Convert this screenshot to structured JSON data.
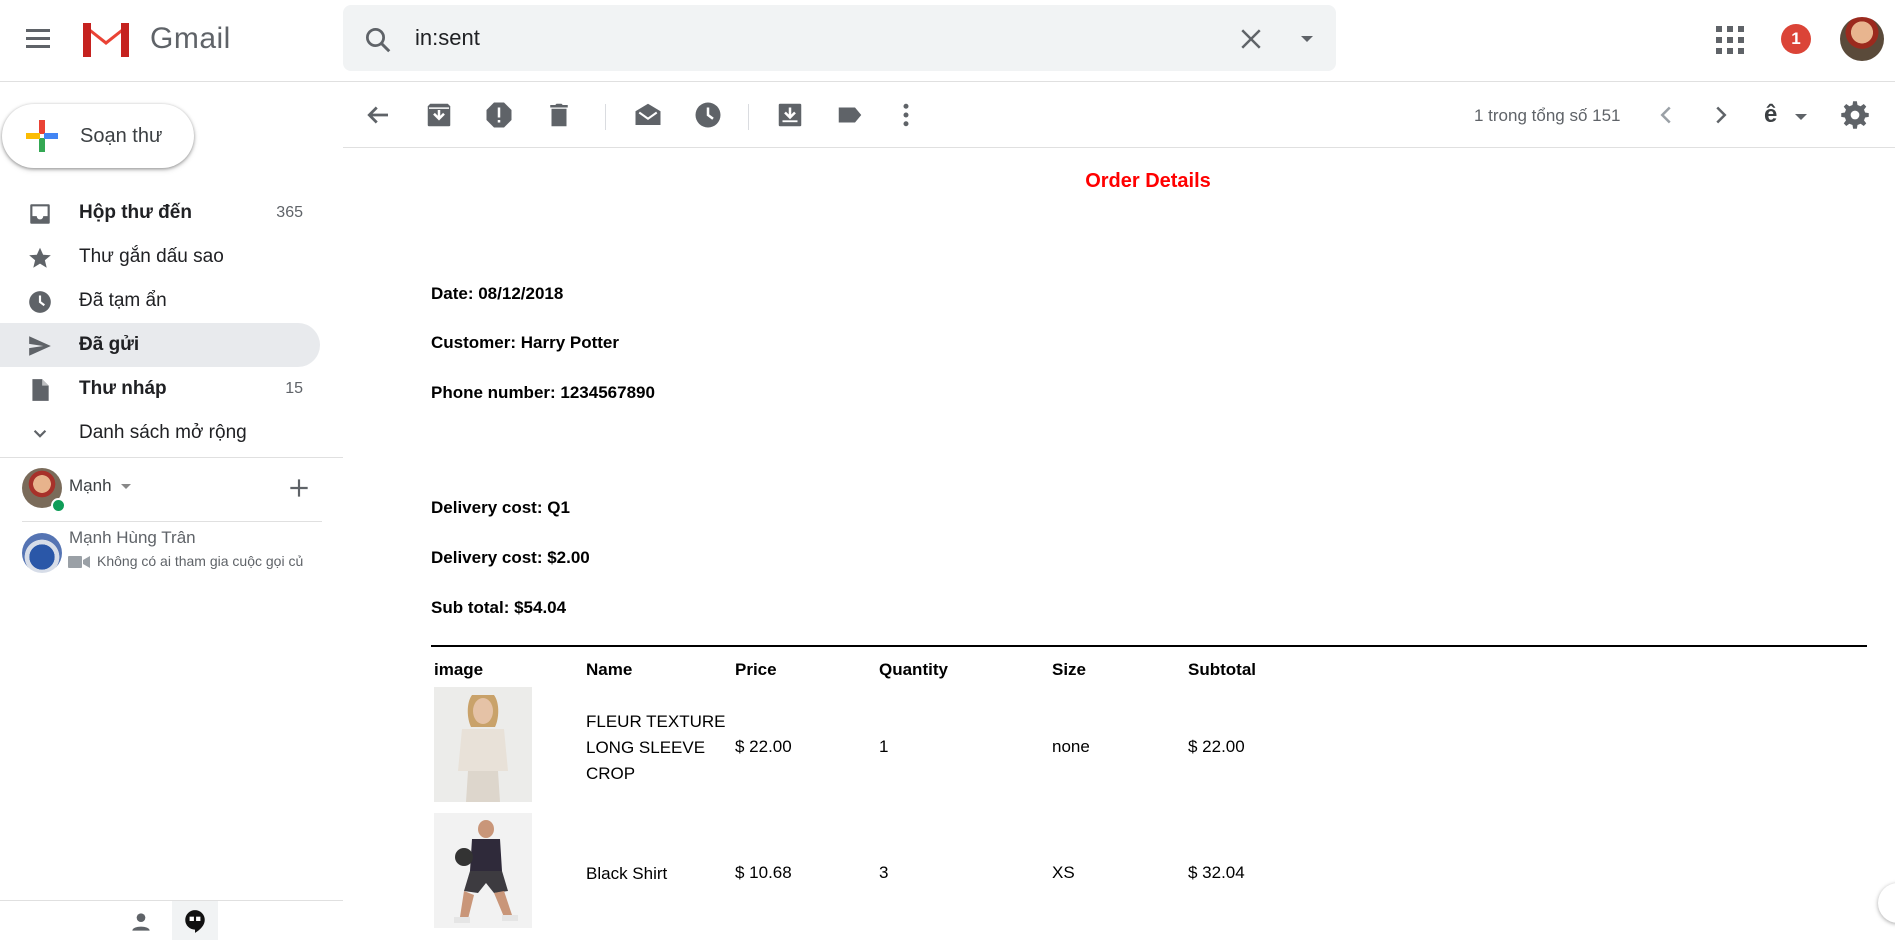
{
  "app": {
    "name": "Gmail"
  },
  "search": {
    "value": "in:sent"
  },
  "header": {
    "notification_count": "1"
  },
  "compose": {
    "label": "Soạn thư"
  },
  "nav": [
    {
      "label": "Hộp thư đến",
      "count": "365",
      "icon": "inbox-icon",
      "bold": true,
      "active": false
    },
    {
      "label": "Thư gắn dấu sao",
      "count": "",
      "icon": "star-icon",
      "bold": false,
      "active": false
    },
    {
      "label": "Đã tạm ẩn",
      "count": "",
      "icon": "clock-icon",
      "bold": false,
      "active": false
    },
    {
      "label": "Đã gửi",
      "count": "",
      "icon": "send-icon",
      "bold": true,
      "active": true
    },
    {
      "label": "Thư nháp",
      "count": "15",
      "icon": "draft-icon",
      "bold": true,
      "active": false
    },
    {
      "label": "Danh sách mở rộng",
      "count": "",
      "icon": "chevron-down-icon",
      "bold": false,
      "active": false
    }
  ],
  "hangouts": {
    "me": {
      "name": "Mạnh"
    },
    "contact": {
      "name": "Mạnh Hùng Trân",
      "status": "Không có ai tham gia cuộc gọi củ"
    }
  },
  "toolbar": {
    "page_count": "1 trong tổng số 151",
    "input_tool": "ê"
  },
  "email": {
    "title": "Order Details",
    "date": "Date: 08/12/2018",
    "customer": "Customer: Harry Potter",
    "phone": "Phone number: 1234567890",
    "delivery_area": "Delivery cost: Q1",
    "delivery_cost": "Delivery cost: $2.00",
    "sub_total": "Sub total: $54.04",
    "columns": [
      "image",
      "Name",
      "Price",
      "Quantity",
      "Size",
      "Subtotal"
    ],
    "items": [
      {
        "name": "FLEUR TEXTURE LONG SLEEVE CROP",
        "price": "$ 22.00",
        "quantity": "1",
        "size": "none",
        "subtotal": "$ 22.00"
      },
      {
        "name": "Black Shirt",
        "price": "$ 10.68",
        "quantity": "3",
        "size": "XS",
        "subtotal": "$ 32.04"
      }
    ]
  },
  "colors": {
    "title_red": "#ff0000",
    "active_nav": "#e8eaed",
    "badge_red": "#db4437",
    "online_green": "#0f9d58"
  }
}
